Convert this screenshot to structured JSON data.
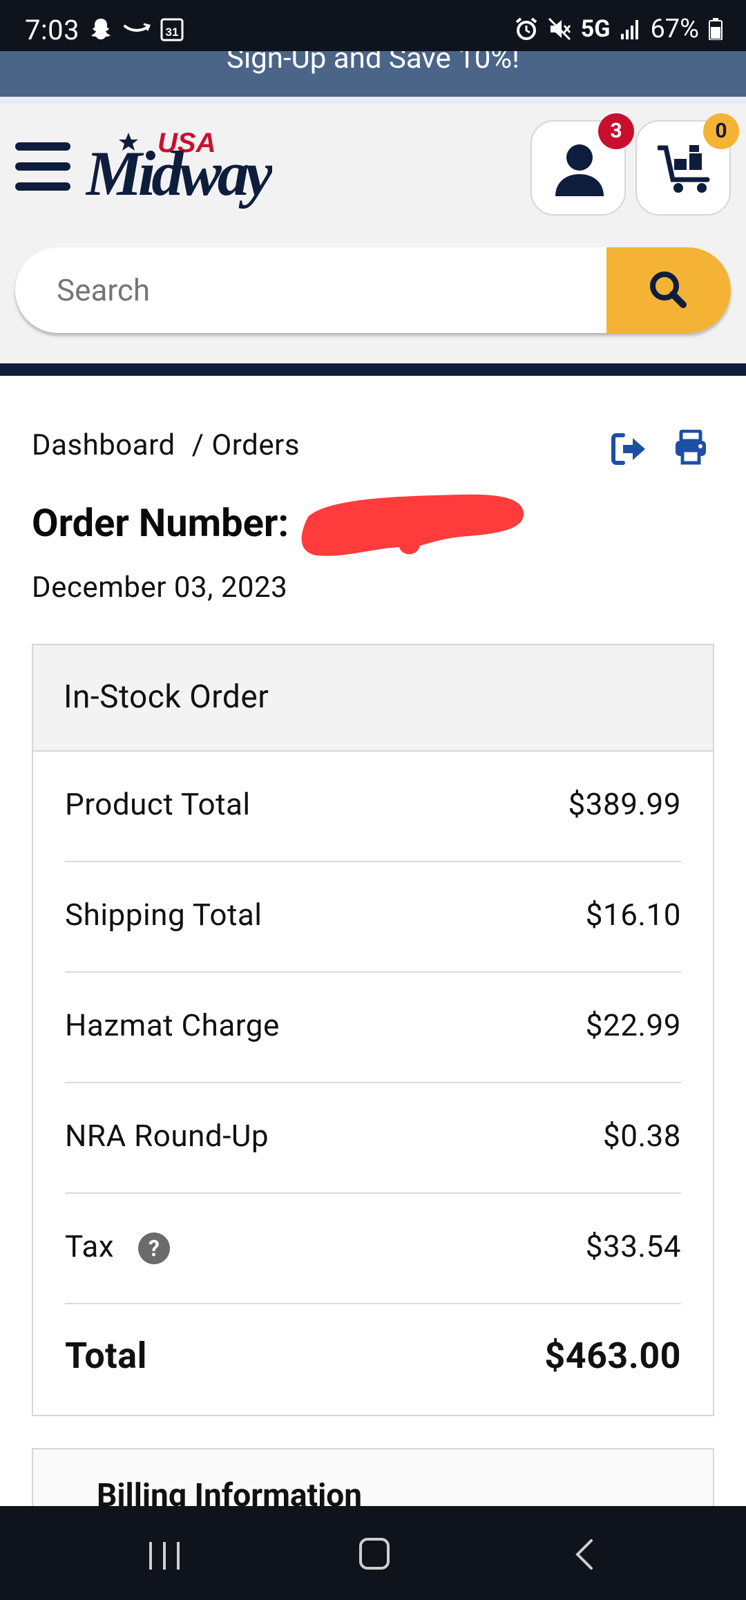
{
  "status_bar": {
    "time": "7:03",
    "network": "5G",
    "battery": "67%"
  },
  "promo": {
    "text": "Sign-Up and Save 10%!"
  },
  "header": {
    "account_badge": "3",
    "cart_badge": "0",
    "search": {
      "placeholder": "Search"
    },
    "colors": {
      "navy": "#0f1d3d",
      "accent": "#f5b335",
      "brand_red": "#c8102e"
    }
  },
  "breadcrumb": {
    "items": [
      "Dashboard",
      "/ Orders"
    ]
  },
  "order": {
    "number_label": "Order Number:",
    "date": "December 03, 2023"
  },
  "summary": {
    "heading": "In-Stock Order",
    "rows": [
      {
        "label": "Product Total",
        "value": "$389.99"
      },
      {
        "label": "Shipping Total",
        "value": "$16.10"
      },
      {
        "label": "Hazmat Charge",
        "value": "$22.99"
      },
      {
        "label": "NRA Round-Up",
        "value": "$0.38"
      },
      {
        "label": "Tax",
        "value": "$33.54"
      }
    ],
    "total": {
      "label": "Total",
      "value": "$463.00"
    }
  },
  "billing": {
    "title": "Billing Information"
  }
}
